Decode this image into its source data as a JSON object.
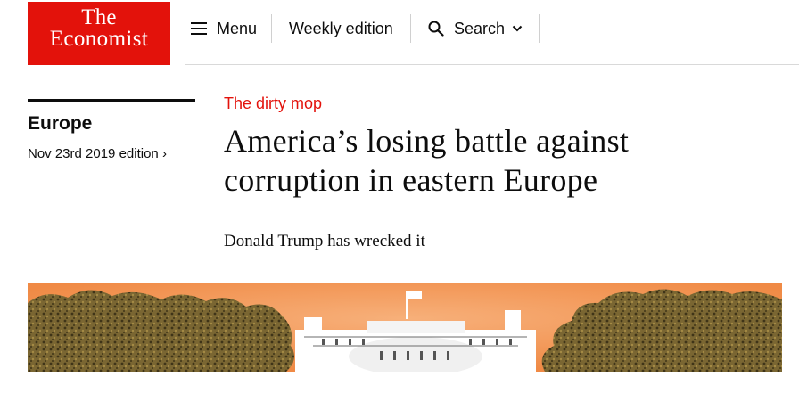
{
  "header": {
    "logo": {
      "line1": "The",
      "line2": "Economist"
    },
    "menu_label": "Menu",
    "weekly_edition_label": "Weekly edition",
    "search_label": "Search"
  },
  "sidebar": {
    "section_title": "Europe",
    "edition_link": "Nov 23rd 2019 edition ›"
  },
  "article": {
    "rubric": "The dirty mop",
    "headline": "America’s losing battle against corruption in eastern Europe",
    "standfirst": "Donald Trump has wrecked it"
  },
  "colors": {
    "brand_red": "#e3120b",
    "hero_background": "#f39c5a",
    "foliage": "#6b5a2e"
  }
}
